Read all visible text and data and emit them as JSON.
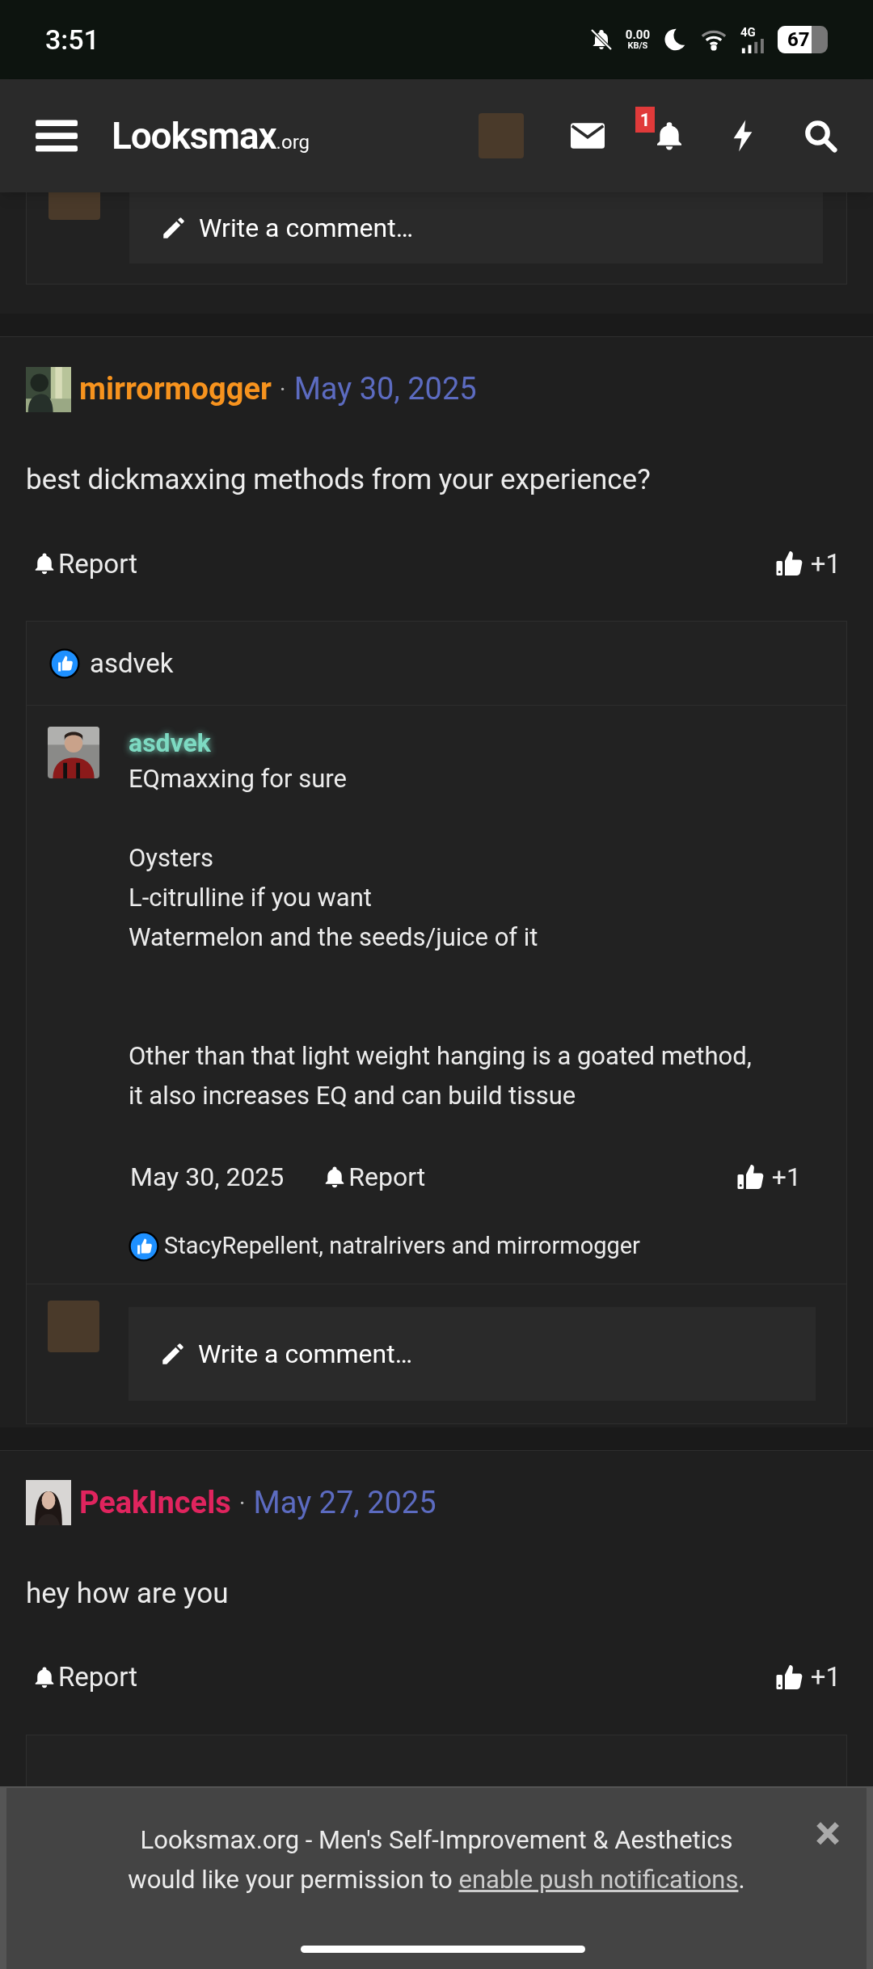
{
  "status_bar": {
    "time": "3:51",
    "speed_value": "0.00",
    "speed_unit": "KB/S",
    "network": "4G",
    "battery": "67"
  },
  "header": {
    "logo": "Looksmax",
    "logo_suffix": ".org",
    "alert_count": "1"
  },
  "top_comment": {
    "placeholder": "Write a comment…"
  },
  "posts": [
    {
      "user": "mirrormogger",
      "color": "#f7931e",
      "separator": "·",
      "date": "May 30, 2025",
      "body": "best dickmaxxing methods from your experience?",
      "report": "Report",
      "likes": "+1",
      "reactions": "asdvek",
      "replies": [
        {
          "user": "asdvek",
          "color": "#7ddac2",
          "body": "EQmaxxing for sure\n\nOysters\nL-citrulline if you want\nWatermelon and the seeds/juice of it\n\n\nOther than that light weight hanging is a goated method, it also increases EQ and can build tissue",
          "date": "May 30, 2025",
          "report": "Report",
          "likes": "+1",
          "reactions": "StacyRepellent, natralrivers and mirrormogger"
        }
      ],
      "comment_placeholder": "Write a comment…"
    },
    {
      "user": "PeakIncels",
      "color": "#e0245e",
      "separator": "·",
      "date": "May 27, 2025",
      "body": "hey how are you",
      "report": "Report",
      "likes": "+1"
    }
  ],
  "banner": {
    "text_before": "Looksmax.org - Men's Self-Improvement & Aesthetics would like your permission to ",
    "link": "enable push notifications",
    "text_after": ".",
    "close": "×"
  }
}
